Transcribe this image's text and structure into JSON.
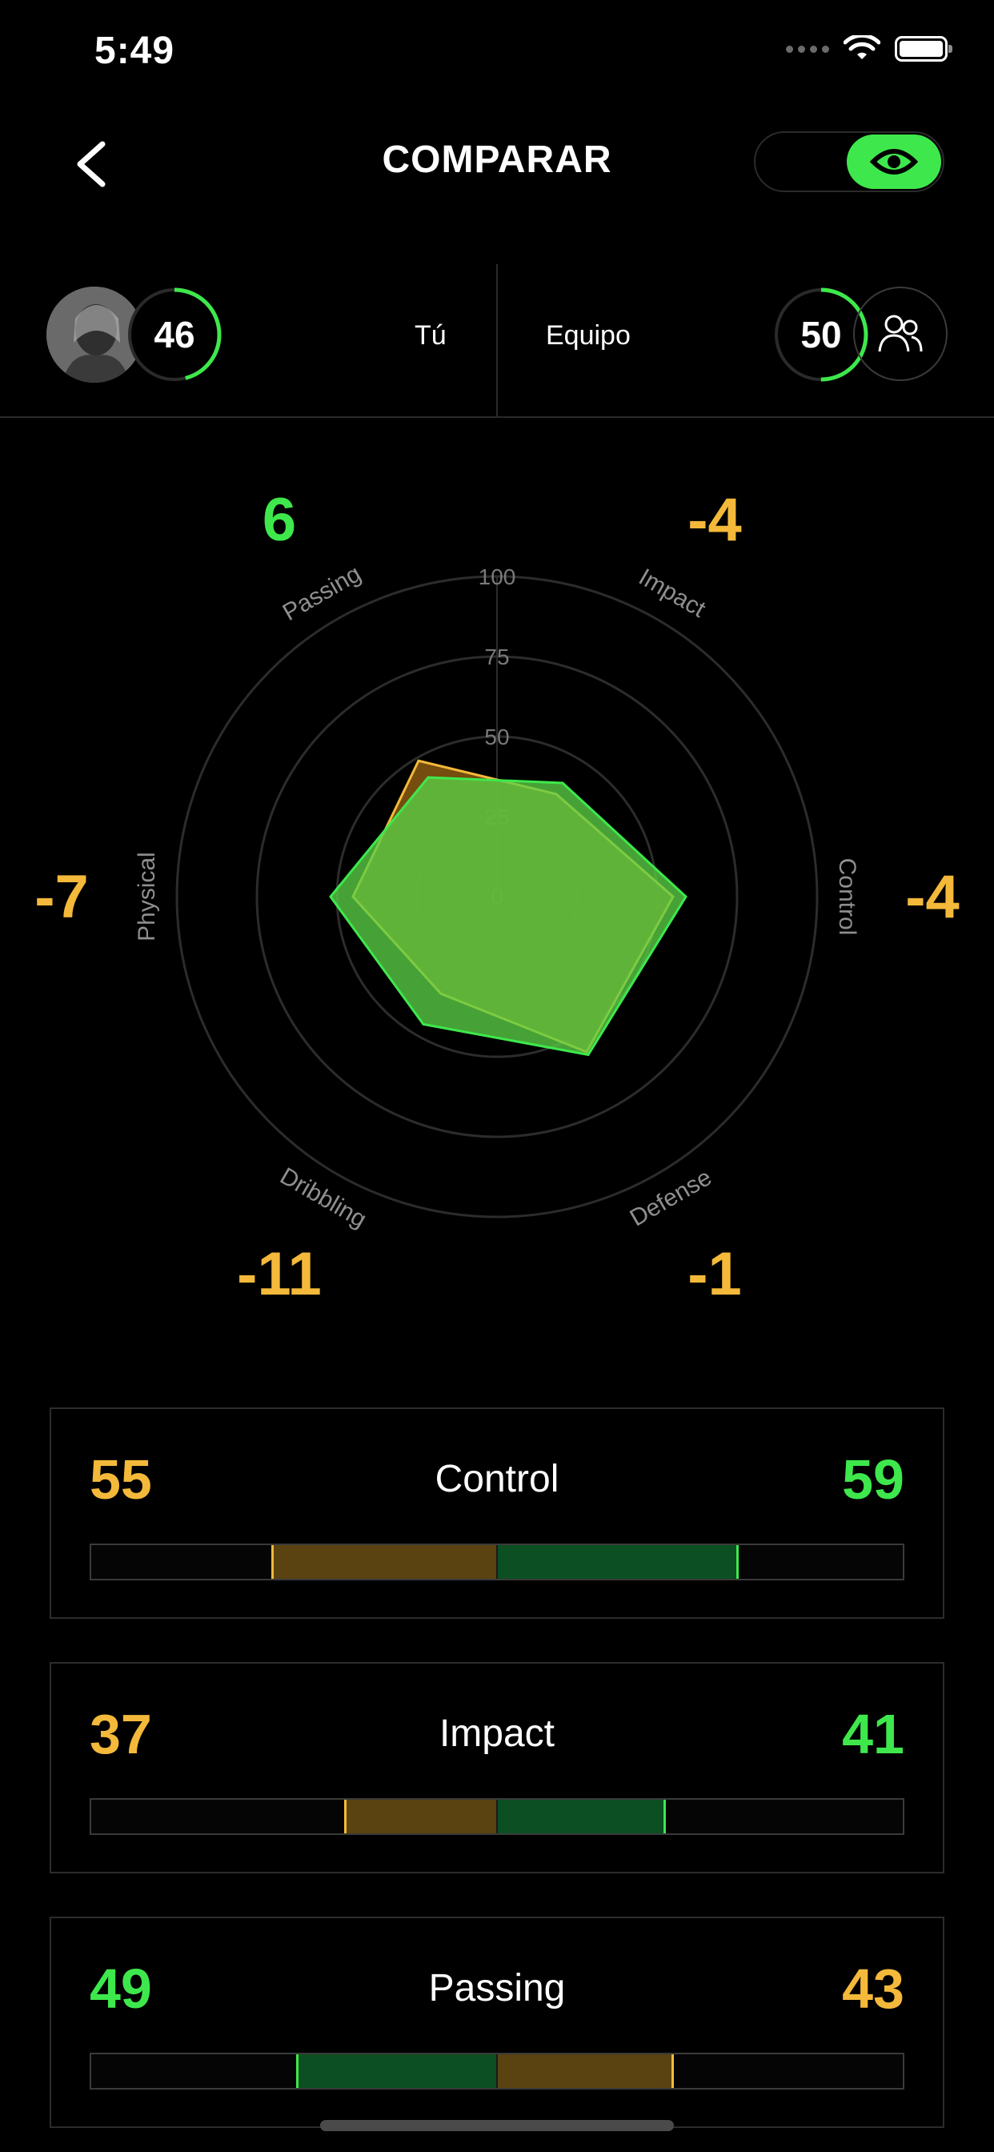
{
  "status": {
    "time": "5:49"
  },
  "header": {
    "title": "COMPARAR"
  },
  "compare": {
    "you": {
      "label": "Tú",
      "score": "46",
      "score_fraction": 0.46,
      "avatar": "player-photo"
    },
    "team": {
      "label": "Equipo",
      "score": "50",
      "score_fraction": 0.5
    }
  },
  "radar": {
    "ticks": [
      "100",
      "75",
      "50",
      "25",
      "0"
    ],
    "axes": [
      {
        "label": "Control",
        "diff": "-4",
        "you": 55,
        "team": 59
      },
      {
        "label": "Impact",
        "diff": "-4",
        "you": 37,
        "team": 41
      },
      {
        "label": "Passing",
        "diff": "6",
        "you": 49,
        "team": 43
      },
      {
        "label": "Physical",
        "diff": "-7",
        "you": 45,
        "team": 52
      },
      {
        "label": "Dribbling",
        "diff": "-11",
        "you": 35,
        "team": 46
      },
      {
        "label": "Defense",
        "diff": "-1",
        "you": 56,
        "team": 57
      }
    ]
  },
  "cards": [
    {
      "name": "Control",
      "left": "55",
      "right": "59",
      "left_value": 55,
      "right_value": 59,
      "left_color": "#f4b93a",
      "right_color": "#3ee84c"
    },
    {
      "name": "Impact",
      "left": "37",
      "right": "41",
      "left_value": 37,
      "right_value": 41,
      "left_color": "#f4b93a",
      "right_color": "#3ee84c"
    },
    {
      "name": "Passing",
      "left": "49",
      "right": "43",
      "left_value": 49,
      "right_value": 43,
      "left_color": "#3ee84c",
      "right_color": "#f4b93a"
    }
  ],
  "colors": {
    "green": "#3ee84c",
    "yellow": "#f4b93a",
    "green_dark": "#0b4f22",
    "yellow_dark": "#5a4311"
  }
}
